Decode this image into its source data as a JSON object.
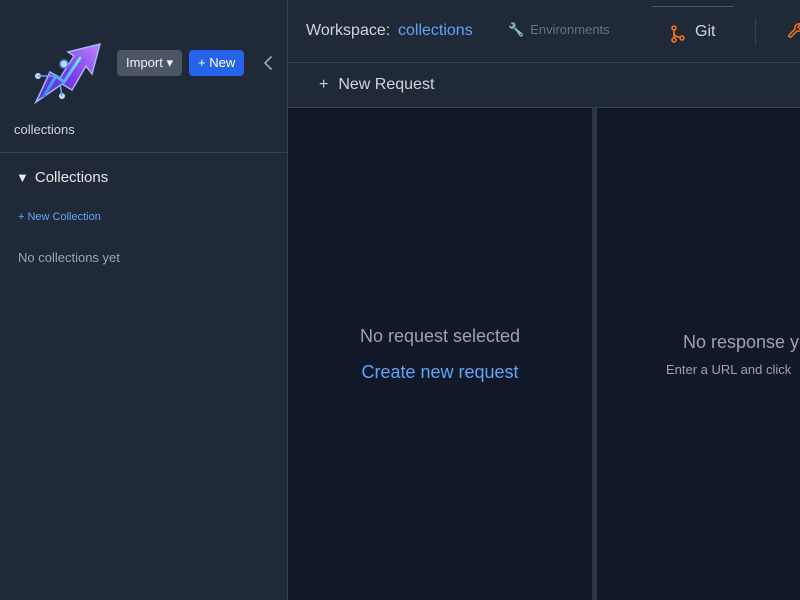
{
  "colors": {
    "background": "#111827",
    "panel": "#1f2937",
    "accent_blue": "#2563eb",
    "link_blue": "#60a5fa",
    "git_orange": "#f97316"
  },
  "sidebar": {
    "logo_icon": "rocket-arrow-logo",
    "import_label": "Import ▾",
    "new_label": "+ New",
    "collapse_icon": "chevron-left-icon",
    "workspace_label": "collections",
    "section": {
      "title": "Collections",
      "toggle_icon": "▼",
      "new_link": "+ New Collection",
      "empty_text": "No collections yet"
    }
  },
  "topbar": {
    "workspace_prefix": "Workspace:",
    "workspace_name": "collections",
    "environments_icon": "🔧",
    "environments_label": "Environments",
    "git_icon": "git-branch-icon",
    "git_label": "Git",
    "extra_icon": "wrench-icon"
  },
  "request_bar": {
    "plus": "+",
    "new_request_label": "New Request"
  },
  "request_pane": {
    "empty_title": "No request selected",
    "create_link": "Create new request"
  },
  "response_pane": {
    "empty_title": "No response y",
    "hint": "Enter a URL and click"
  }
}
